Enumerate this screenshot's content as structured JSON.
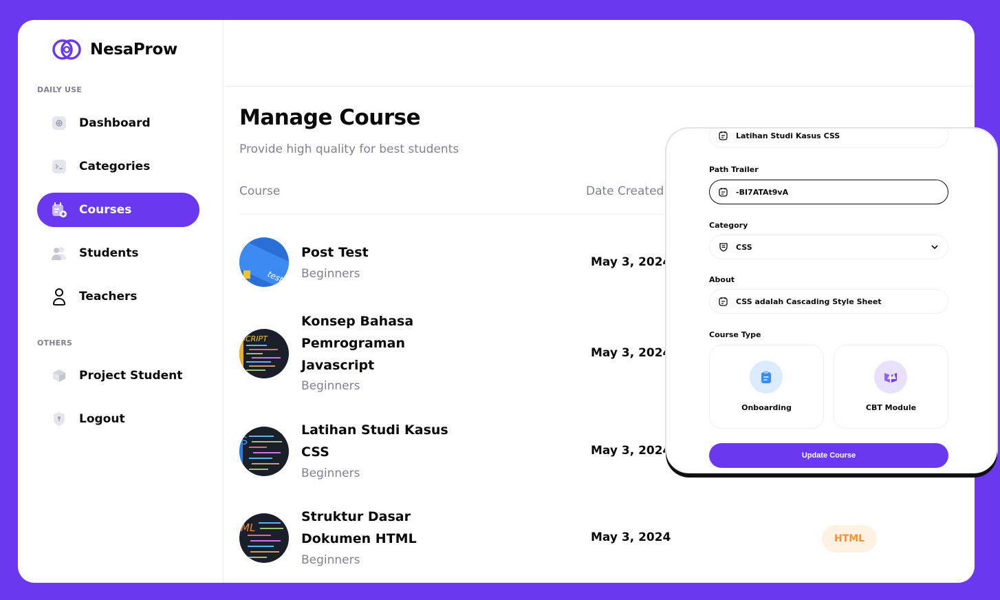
{
  "app": {
    "name": "NesaProw"
  },
  "sidebar": {
    "daily_use_label": "DAILY USE",
    "others_label": "OTHERS",
    "items": [
      {
        "label": "Dashboard",
        "icon": "dashboard-icon"
      },
      {
        "label": "Categories",
        "icon": "terminal-icon"
      },
      {
        "label": "Courses",
        "icon": "calendar-add-icon",
        "active": true
      },
      {
        "label": "Students",
        "icon": "people-icon"
      },
      {
        "label": "Teachers",
        "icon": "user-icon"
      }
    ],
    "others": [
      {
        "label": "Project Student",
        "icon": "box-icon"
      },
      {
        "label": "Logout",
        "icon": "shield-icon"
      }
    ]
  },
  "main": {
    "title": "Manage Course",
    "subtitle": "Provide high quality for best students",
    "columns": {
      "course": "Course",
      "date_created": "Date Created"
    },
    "rows": [
      {
        "title": "Post Test",
        "level": "Beginners",
        "date": "May 3, 2024",
        "thumb_text": "test"
      },
      {
        "title": "Konsep Bahasa Pemrograman Javascript",
        "level": "Beginners",
        "date": "May 3, 2024",
        "thumb_text": "SCRIPT"
      },
      {
        "title": "Latihan Studi Kasus CSS",
        "level": "Beginners",
        "date": "May 3, 2024",
        "thumb_text": "S"
      },
      {
        "title": "Struktur Dasar Dokumen HTML",
        "level": "Beginners",
        "date": "May 3, 2024",
        "thumb_text": "ML",
        "badge": "HTML"
      }
    ]
  },
  "form": {
    "name_value": "Latihan Studi Kasus CSS",
    "path_trailer_label": "Path Trailer",
    "path_trailer_value": "-BI7ATAt9vA",
    "category_label": "Category",
    "category_value": "CSS",
    "about_label": "About",
    "about_value": "CSS adalah Cascading Style Sheet",
    "course_type_label": "Course Type",
    "types": [
      {
        "label": "Onboarding",
        "icon": "clipboard-icon"
      },
      {
        "label": "CBT Module",
        "icon": "book-icon"
      }
    ],
    "submit_label": "Update Course"
  },
  "colors": {
    "brand": "#6938EF",
    "badge_html": "#FF8F2E"
  }
}
